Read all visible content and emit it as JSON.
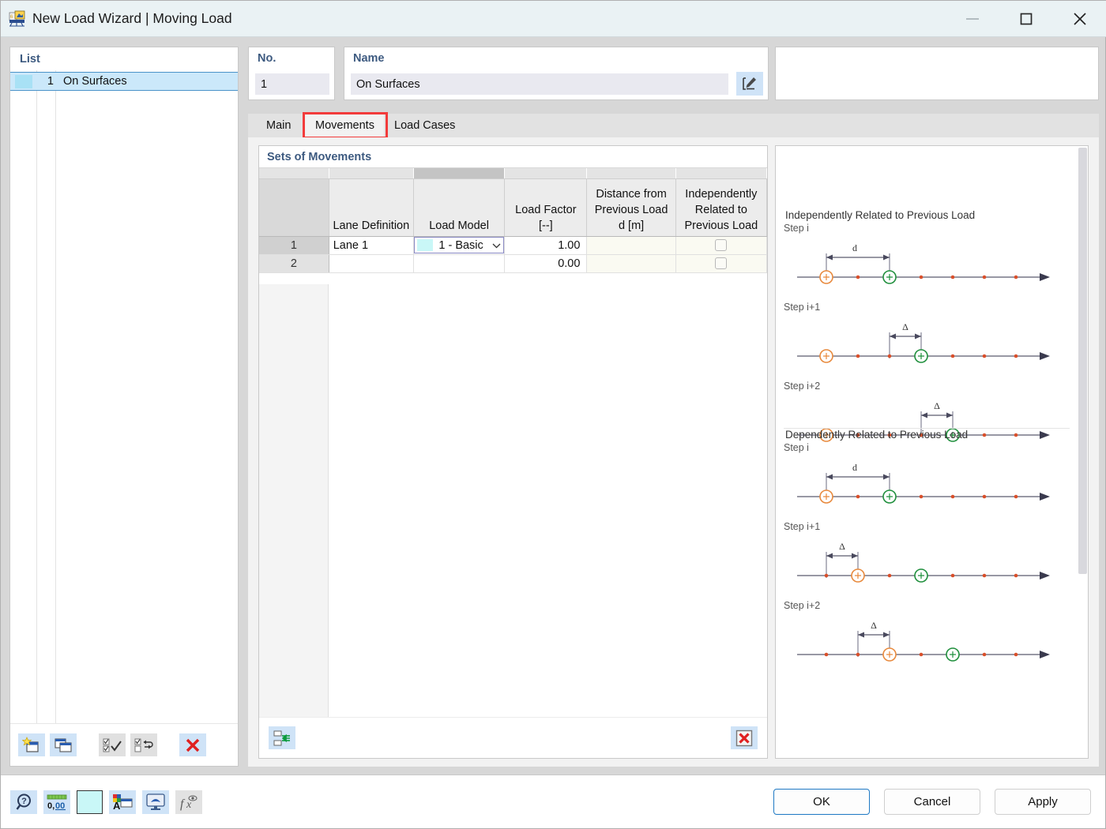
{
  "window": {
    "title": "New Load Wizard | Moving Load",
    "icon": "app-icon",
    "controls": {
      "minimize": "—",
      "maximize": "▢",
      "close": "✕"
    }
  },
  "list_panel": {
    "header": "List",
    "rows": [
      {
        "num": "1",
        "name": "On Surfaces",
        "color": "#a8e1f5"
      }
    ],
    "toolbar": [
      {
        "name": "new-item-button",
        "icon": "new-window-star-icon",
        "enabled": true
      },
      {
        "name": "copy-item-button",
        "icon": "copy-window-icon",
        "enabled": true
      },
      {
        "name": "select-all-button",
        "icon": "check-all-icon",
        "enabled": false
      },
      {
        "name": "invert-selection-button",
        "icon": "invert-check-icon",
        "enabled": false
      },
      {
        "name": "delete-item-button",
        "icon": "red-x-icon",
        "enabled": true
      }
    ]
  },
  "no_field": {
    "label": "No.",
    "value": "1"
  },
  "name_field": {
    "label": "Name",
    "value": "On Surfaces",
    "edit_icon": "edit-pencil-icon"
  },
  "tabs": {
    "items": [
      {
        "label": "Main",
        "active": false
      },
      {
        "label": "Movements",
        "active": true,
        "highlighted": true
      },
      {
        "label": "Load Cases",
        "active": false
      }
    ]
  },
  "table": {
    "title": "Sets of Movements",
    "columns": [
      {
        "key": "rownum",
        "label": ""
      },
      {
        "key": "lane",
        "label": "Lane Definition"
      },
      {
        "key": "model",
        "label": "Load Model",
        "selected": true
      },
      {
        "key": "factor",
        "label": "Load Factor\n[--]",
        "line1": "Load Factor",
        "line2": "[--]"
      },
      {
        "key": "dist",
        "label": "Distance from Previous Load d [m]",
        "line1": "Distance from",
        "line2": "Previous Load",
        "line3": "d [m]"
      },
      {
        "key": "indep",
        "label": "Independently Related to Previous Load",
        "line1": "Independently",
        "line2": "Related to",
        "line3": "Previous Load"
      }
    ],
    "rows": [
      {
        "rownum": "1",
        "lane": "Lane 1",
        "model": {
          "text": "1 - Basic",
          "swatch": "#c9f7f7",
          "chevron": "chevron-down-icon"
        },
        "factor": "1.00",
        "dist": "",
        "indep": false
      },
      {
        "rownum": "2",
        "lane": "",
        "model": {
          "text": "",
          "swatch": "",
          "chevron": ""
        },
        "factor": "0.00",
        "dist": "",
        "indep": false
      }
    ],
    "toolbar": [
      {
        "name": "import-rows-button",
        "icon": "import-green-arrow-icon"
      },
      {
        "name": "delete-rows-button",
        "icon": "red-x-box-icon"
      }
    ]
  },
  "diagrams": [
    {
      "caption": "Independently Related to Previous Load",
      "steps": [
        {
          "label": "Step i",
          "dim_label": "d",
          "orange_index": 0,
          "green_index": 2,
          "dim_from": 0,
          "dim_to": 2
        },
        {
          "label": "Step i+1",
          "dim_label": "Δ",
          "orange_index": 0,
          "green_index": 3,
          "dim_from": 2,
          "dim_to": 3
        },
        {
          "label": "Step i+2",
          "dim_label": "Δ",
          "orange_index": 0,
          "green_index": 4,
          "dim_from": 3,
          "dim_to": 4
        }
      ]
    },
    {
      "caption": "Dependently Related to Previous Load",
      "steps": [
        {
          "label": "Step i",
          "dim_label": "d",
          "orange_index": 0,
          "green_index": 2,
          "dim_from": 0,
          "dim_to": 2
        },
        {
          "label": "Step i+1",
          "dim_label": "Δ",
          "orange_index": 1,
          "green_index": 3,
          "dim_from": 0,
          "dim_to": 1
        },
        {
          "label": "Step i+2",
          "dim_label": "Δ",
          "orange_index": 2,
          "green_index": 4,
          "dim_from": 1,
          "dim_to": 2
        }
      ]
    }
  ],
  "bottom_toolbar": [
    {
      "name": "help-button",
      "icon": "help-magnifier-icon",
      "enabled": true
    },
    {
      "name": "decimal-places-button",
      "icon": "decimal-0-00-icon",
      "enabled": true
    },
    {
      "name": "color-swatch-button",
      "icon": "color-swatch-icon",
      "enabled": true,
      "color": "#c9f7f7"
    },
    {
      "name": "display-properties-button",
      "icon": "color-letter-a-icon",
      "enabled": true
    },
    {
      "name": "view-settings-button",
      "icon": "monitor-icon",
      "enabled": true
    },
    {
      "name": "formula-button",
      "icon": "fx-icon",
      "enabled": false
    }
  ],
  "dialog_buttons": [
    {
      "label": "OK",
      "primary": true,
      "name": "ok-button"
    },
    {
      "label": "Cancel",
      "primary": false,
      "name": "cancel-button"
    },
    {
      "label": "Apply",
      "primary": false,
      "name": "apply-button"
    }
  ]
}
